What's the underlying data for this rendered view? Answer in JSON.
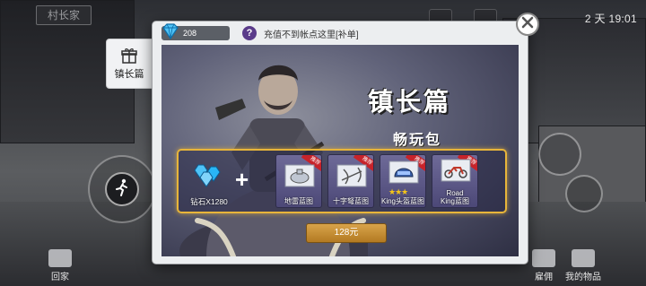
{
  "background": {
    "sign_text": "村长家",
    "time_text": "2 天 19:01",
    "accent_gold": "#e8b53a",
    "banner_purple": "#4c4877"
  },
  "side_tab": {
    "label": "镇长篇",
    "icon": "gift-icon"
  },
  "bottom_nav": {
    "home_label": "回家",
    "hire_label": "雇佣",
    "items_label": "我的物品"
  },
  "modal": {
    "gem_count": "208",
    "help_icon": "?",
    "recharge_hint": "充值不到帐点这里[补单]",
    "title": "镇长篇",
    "subtitle": "畅玩包",
    "plus": "+",
    "price": "128元",
    "rewards": [
      {
        "label": "钻石X1280",
        "icon": "diamond-pile-icon",
        "badge": ""
      },
      {
        "label": "地雷蓝图",
        "icon": "landmine-blueprint-icon",
        "badge": "推荐"
      },
      {
        "label": "十字弩蓝图",
        "icon": "crossbow-blueprint-icon",
        "badge": "推荐"
      },
      {
        "label": "King头盔蓝图",
        "icon": "helmet-blueprint-icon",
        "badge": "推荐",
        "stars": 3
      },
      {
        "label": "Road King蓝图",
        "label_line1": "Road",
        "label_line2": "King蓝图",
        "icon": "motorcycle-blueprint-icon",
        "badge": "推荐"
      }
    ]
  }
}
